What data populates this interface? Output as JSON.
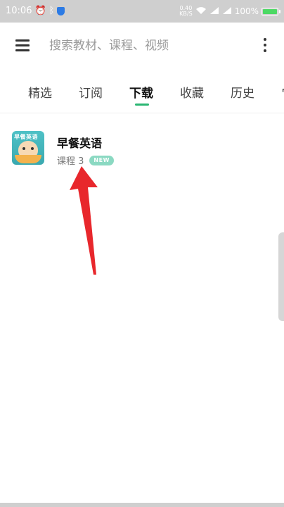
{
  "status_bar": {
    "time": "10:06",
    "net_speed_top": "0.40",
    "net_speed_bottom": "KB/S",
    "battery": "100%",
    "battery_level": 1.0
  },
  "header": {
    "search_placeholder": "搜索教材、课程、视频"
  },
  "tabs": [
    {
      "label": "精选"
    },
    {
      "label": "订阅"
    },
    {
      "label": "下载"
    },
    {
      "label": "收藏"
    },
    {
      "label": "历史"
    }
  ],
  "active_tab": "下载",
  "downloads": [
    {
      "title": "早餐英语",
      "cover_text": "早餐英语",
      "subtitle": "课程 3",
      "badge": "NEW"
    }
  ],
  "colors": {
    "accent": "#2bb673",
    "badge": "#8bd9c2",
    "arrow": "#e8272c",
    "status_bar": "#cfcfcf"
  }
}
